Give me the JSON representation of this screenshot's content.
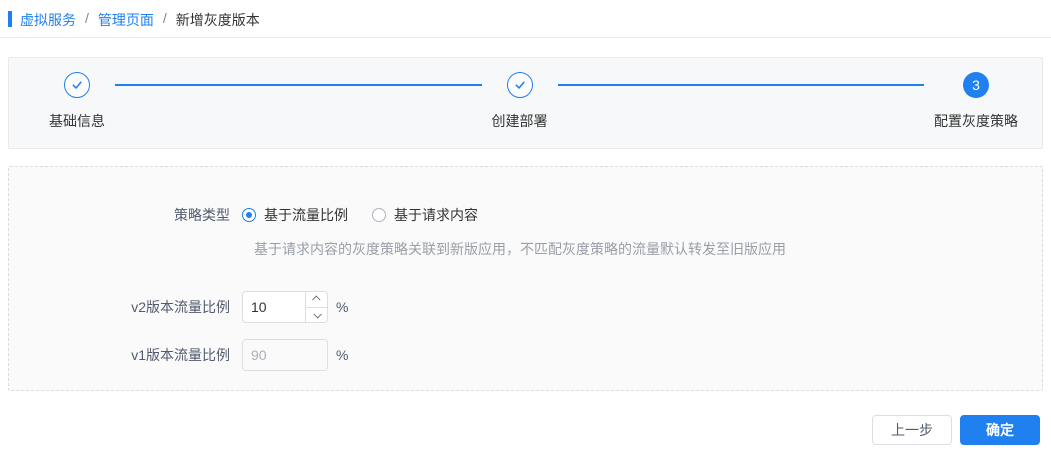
{
  "breadcrumb": {
    "separator": "/",
    "items": [
      {
        "label": "虚拟服务",
        "type": "link"
      },
      {
        "label": "管理页面",
        "type": "link"
      },
      {
        "label": "新增灰度版本",
        "type": "current"
      }
    ]
  },
  "stepper": {
    "steps": [
      {
        "label": "基础信息",
        "status": "finished",
        "icon": "check"
      },
      {
        "label": "创建部署",
        "status": "finished",
        "icon": "check"
      },
      {
        "label": "配置灰度策略",
        "status": "active",
        "number": "3"
      }
    ]
  },
  "form": {
    "policy_type": {
      "label": "策略类型",
      "options": [
        {
          "label": "基于流量比例",
          "selected": true
        },
        {
          "label": "基于请求内容",
          "selected": false
        }
      ],
      "help": "基于请求内容的灰度策略关联到新版应用，不匹配灰度策略的流量默认转发至旧版应用"
    },
    "v2_ratio": {
      "label": "v2版本流量比例",
      "value": "10",
      "unit": "%",
      "disabled": false
    },
    "v1_ratio": {
      "label": "v1版本流量比例",
      "value": "90",
      "unit": "%",
      "disabled": true
    }
  },
  "footer": {
    "prev_label": "上一步",
    "confirm_label": "确定"
  },
  "colors": {
    "primary": "#2080f0",
    "panel_border": "#e8eaec",
    "form_border_dashed": "#d7dde4",
    "helper_text": "#999fa8",
    "disabled_text": "#aab0b8"
  }
}
